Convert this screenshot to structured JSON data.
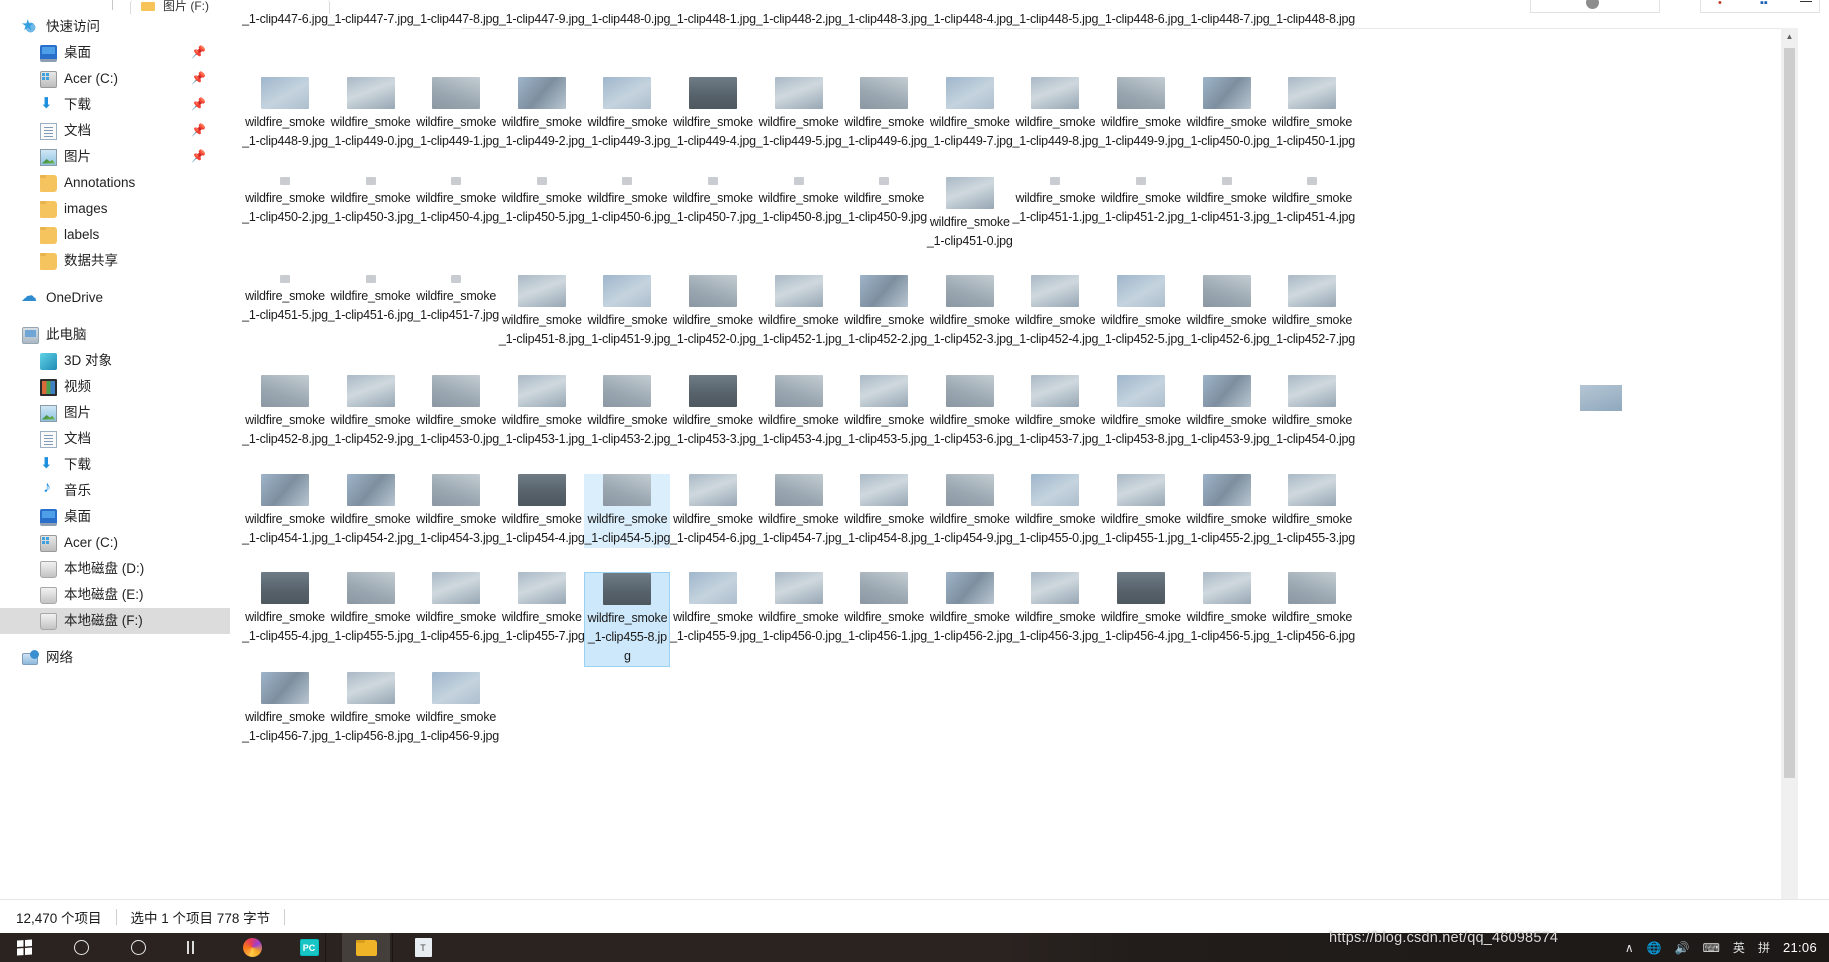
{
  "window": {
    "tab_title": "图片 (F:)",
    "minimize_label": "—"
  },
  "sidebar": {
    "groups": [
      {
        "name": "quick-access",
        "header": {
          "label": "快速访问",
          "icon": "star-icon"
        },
        "items": [
          {
            "label": "桌面",
            "icon": "desktop-icon",
            "pinned": true,
            "indent": 1
          },
          {
            "label": "Acer (C:)",
            "icon": "drive-icon",
            "pinned": true,
            "indent": 1
          },
          {
            "label": "下载",
            "icon": "download-icon",
            "pinned": true,
            "indent": 1
          },
          {
            "label": "文档",
            "icon": "document-icon",
            "pinned": true,
            "indent": 1
          },
          {
            "label": "图片",
            "icon": "pictures-icon",
            "pinned": true,
            "indent": 1
          },
          {
            "label": "Annotations",
            "icon": "folder-icon",
            "pinned": false,
            "indent": 1
          },
          {
            "label": "images",
            "icon": "folder-icon",
            "pinned": false,
            "indent": 1
          },
          {
            "label": "labels",
            "icon": "folder-icon",
            "pinned": false,
            "indent": 1
          },
          {
            "label": "数据共享",
            "icon": "folder-icon",
            "pinned": false,
            "indent": 1
          }
        ]
      },
      {
        "name": "onedrive",
        "header": {
          "label": "OneDrive",
          "icon": "cloud-icon"
        },
        "items": []
      },
      {
        "name": "this-pc",
        "header": {
          "label": "此电脑",
          "icon": "pc-icon"
        },
        "items": [
          {
            "label": "3D 对象",
            "icon": "3d-objects-icon",
            "pinned": false,
            "indent": 1
          },
          {
            "label": "视频",
            "icon": "videos-icon",
            "pinned": false,
            "indent": 1
          },
          {
            "label": "图片",
            "icon": "pictures-icon",
            "pinned": false,
            "indent": 1
          },
          {
            "label": "文档",
            "icon": "document-icon",
            "pinned": false,
            "indent": 1
          },
          {
            "label": "下载",
            "icon": "download-icon",
            "pinned": false,
            "indent": 1
          },
          {
            "label": "音乐",
            "icon": "music-icon",
            "pinned": false,
            "indent": 1
          },
          {
            "label": "桌面",
            "icon": "desktop-icon",
            "pinned": false,
            "indent": 1
          },
          {
            "label": "Acer (C:)",
            "icon": "drive-icon",
            "pinned": false,
            "indent": 1
          },
          {
            "label": "本地磁盘 (D:)",
            "icon": "hdd-icon",
            "pinned": false,
            "indent": 1
          },
          {
            "label": "本地磁盘 (E:)",
            "icon": "hdd-icon",
            "pinned": false,
            "indent": 1
          },
          {
            "label": "本地磁盘 (F:)",
            "icon": "hdd-icon",
            "pinned": false,
            "indent": 1,
            "selected": true
          }
        ]
      },
      {
        "name": "network",
        "header": {
          "label": "网络",
          "icon": "network-icon"
        },
        "items": []
      }
    ]
  },
  "files": {
    "name_prefix": "wildfire_smoke_1-clip",
    "extension": ".jpg",
    "columns": 13,
    "rows": [
      {
        "clipped_top": true,
        "items": [
          {
            "n": "447-6"
          },
          {
            "n": "447-7"
          },
          {
            "n": "447-8"
          },
          {
            "n": "447-9"
          },
          {
            "n": "448-0"
          },
          {
            "n": "448-1"
          },
          {
            "n": "448-2"
          },
          {
            "n": "448-3"
          },
          {
            "n": "448-4"
          },
          {
            "n": "448-5"
          },
          {
            "n": "448-6"
          },
          {
            "n": "448-7"
          },
          {
            "n": "448-8"
          }
        ]
      },
      {
        "items": [
          {
            "n": "448-9",
            "t": "a"
          },
          {
            "n": "449-0",
            "t": "b"
          },
          {
            "n": "449-1",
            "t": "c"
          },
          {
            "n": "449-2",
            "t": "d"
          },
          {
            "n": "449-3",
            "t": "a"
          },
          {
            "n": "449-4",
            "t": "e"
          },
          {
            "n": "449-5",
            "t": "b"
          },
          {
            "n": "449-6",
            "t": "c"
          },
          {
            "n": "449-7",
            "t": "a"
          },
          {
            "n": "449-8",
            "t": "b"
          },
          {
            "n": "449-9",
            "t": "c"
          },
          {
            "n": "450-0",
            "t": "d"
          },
          {
            "n": "450-1",
            "t": "b"
          }
        ]
      },
      {
        "items": [
          {
            "n": "450-2",
            "load": true
          },
          {
            "n": "450-3",
            "load": true
          },
          {
            "n": "450-4",
            "load": true
          },
          {
            "n": "450-5",
            "load": true
          },
          {
            "n": "450-6",
            "load": true
          },
          {
            "n": "450-7",
            "load": true
          },
          {
            "n": "450-8",
            "load": true
          },
          {
            "n": "450-9",
            "load": true
          },
          {
            "n": "451-0",
            "t": "b"
          },
          {
            "n": "451-1",
            "load": true
          },
          {
            "n": "451-2",
            "load": true
          },
          {
            "n": "451-3",
            "load": true
          },
          {
            "n": "451-4",
            "load": true
          }
        ]
      },
      {
        "items": [
          {
            "n": "451-5",
            "load": true
          },
          {
            "n": "451-6",
            "load": true
          },
          {
            "n": "451-7",
            "load": true
          },
          {
            "n": "451-8",
            "t": "b"
          },
          {
            "n": "451-9",
            "t": "a"
          },
          {
            "n": "452-0",
            "t": "c"
          },
          {
            "n": "452-1",
            "t": "b"
          },
          {
            "n": "452-2",
            "t": "d"
          },
          {
            "n": "452-3",
            "t": "c"
          },
          {
            "n": "452-4",
            "t": "b"
          },
          {
            "n": "452-5",
            "t": "a"
          },
          {
            "n": "452-6",
            "t": "c"
          },
          {
            "n": "452-7",
            "t": "b"
          }
        ]
      },
      {
        "items": [
          {
            "n": "452-8",
            "t": "c"
          },
          {
            "n": "452-9",
            "t": "b"
          },
          {
            "n": "453-0",
            "t": "c"
          },
          {
            "n": "453-1",
            "t": "b"
          },
          {
            "n": "453-2",
            "t": "c"
          },
          {
            "n": "453-3",
            "t": "e"
          },
          {
            "n": "453-4",
            "t": "c"
          },
          {
            "n": "453-5",
            "t": "b"
          },
          {
            "n": "453-6",
            "t": "c"
          },
          {
            "n": "453-7",
            "t": "b"
          },
          {
            "n": "453-8",
            "t": "a"
          },
          {
            "n": "453-9",
            "t": "d"
          },
          {
            "n": "454-0",
            "t": "b"
          }
        ]
      },
      {
        "items": [
          {
            "n": "454-1",
            "t": "d"
          },
          {
            "n": "454-2",
            "t": "d"
          },
          {
            "n": "454-3",
            "t": "c"
          },
          {
            "n": "454-4",
            "t": "e"
          },
          {
            "n": "454-5",
            "t": "c",
            "sel": "light"
          },
          {
            "n": "454-6",
            "t": "b"
          },
          {
            "n": "454-7",
            "t": "c"
          },
          {
            "n": "454-8",
            "t": "b"
          },
          {
            "n": "454-9",
            "t": "c"
          },
          {
            "n": "455-0",
            "t": "a"
          },
          {
            "n": "455-1",
            "t": "b"
          },
          {
            "n": "455-2",
            "t": "d"
          },
          {
            "n": "455-3",
            "t": "b"
          }
        ]
      },
      {
        "items": [
          {
            "n": "455-4",
            "t": "e"
          },
          {
            "n": "455-5",
            "t": "c"
          },
          {
            "n": "455-6",
            "t": "b"
          },
          {
            "n": "455-7",
            "t": "b"
          },
          {
            "n": "455-8",
            "t": "e",
            "sel": "strong"
          },
          {
            "n": "455-9",
            "t": "a"
          },
          {
            "n": "456-0",
            "t": "b"
          },
          {
            "n": "456-1",
            "t": "c"
          },
          {
            "n": "456-2",
            "t": "d"
          },
          {
            "n": "456-3",
            "t": "b"
          },
          {
            "n": "456-4",
            "t": "e"
          },
          {
            "n": "456-5",
            "t": "b"
          },
          {
            "n": "456-6",
            "t": "c"
          }
        ]
      },
      {
        "items": [
          {
            "n": "456-7",
            "t": "d"
          },
          {
            "n": "456-8",
            "t": "b"
          },
          {
            "n": "456-9",
            "t": "a"
          }
        ]
      }
    ]
  },
  "status": {
    "item_count": "12,470 个项目",
    "selection": "选中 1 个项目  778 字节"
  },
  "taskbar": {
    "buttons": [
      {
        "name": "start-button",
        "icon": "windows-logo-icon"
      },
      {
        "name": "search-button",
        "icon": "search-circle-icon"
      },
      {
        "name": "cortana-button",
        "icon": "cortana-circle-icon"
      },
      {
        "name": "task-view-button",
        "icon": "task-view-icon"
      },
      {
        "name": "firefox-button",
        "icon": "firefox-icon"
      },
      {
        "name": "pycharm-button",
        "icon": "pycharm-icon",
        "label": "PC"
      },
      {
        "name": "file-explorer-button",
        "icon": "folder-icon",
        "active": true
      },
      {
        "name": "text-editor-button",
        "icon": "text-file-icon",
        "label": "T"
      }
    ],
    "tray": [
      "∧",
      "🌐",
      "🔊",
      "⌨",
      "英",
      "拼"
    ],
    "clock": "21:06"
  },
  "watermark": "https://blog.csdn.net/qq_46098574",
  "colors": {
    "selection_light": "#dbeefc",
    "selection_strong": "#cde8fa",
    "selection_border": "#9ad2f2",
    "sidebar_selected": "#dcdcdc",
    "taskbar_bg": "#1f1b19",
    "text": "#1a1a1a"
  }
}
